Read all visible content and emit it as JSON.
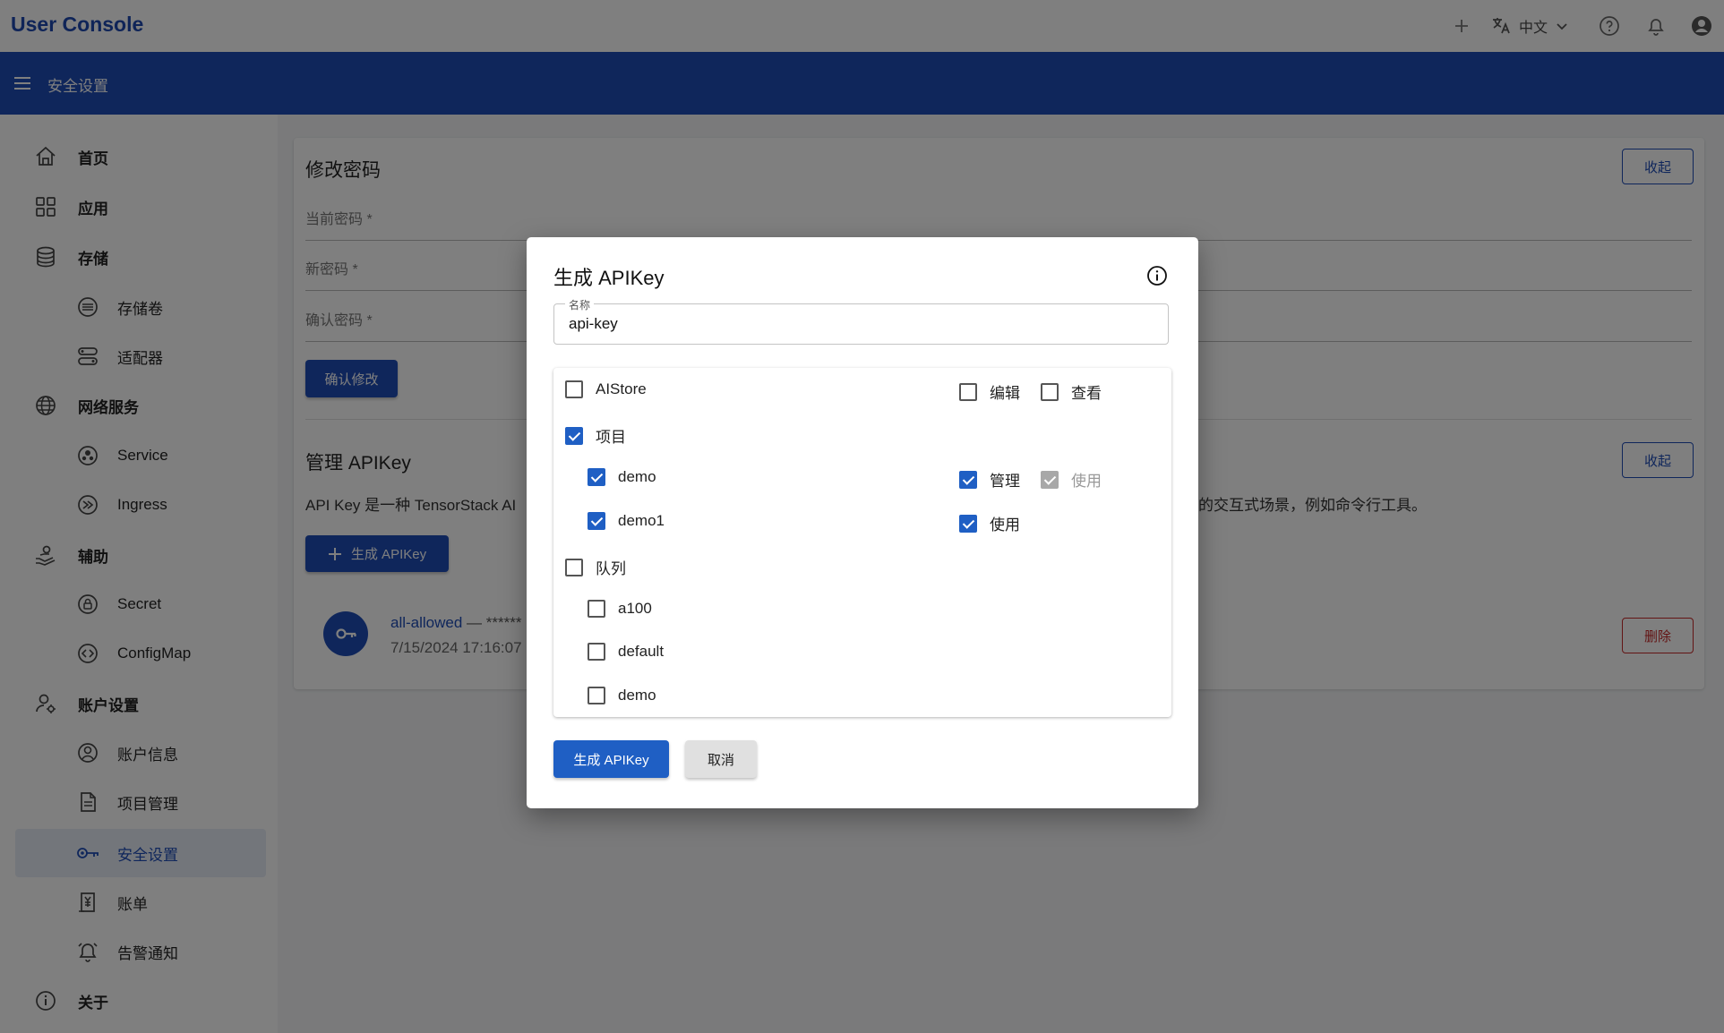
{
  "header": {
    "brand": "User Console",
    "language": "中文"
  },
  "subbar": {
    "title": "安全设置"
  },
  "sidebar": {
    "items": [
      {
        "label": "首页",
        "icon": "home-icon"
      },
      {
        "label": "应用",
        "icon": "apps-icon"
      },
      {
        "label": "存储",
        "icon": "database-icon"
      },
      {
        "label": "存储卷",
        "icon": "volume-icon"
      },
      {
        "label": "适配器",
        "icon": "adapter-icon"
      },
      {
        "label": "网络服务",
        "icon": "globe-icon"
      },
      {
        "label": "Service",
        "icon": "service-icon"
      },
      {
        "label": "Ingress",
        "icon": "ingress-icon"
      },
      {
        "label": "辅助",
        "icon": "assist-icon"
      },
      {
        "label": "Secret",
        "icon": "lock-icon"
      },
      {
        "label": "ConfigMap",
        "icon": "code-icon"
      },
      {
        "label": "账户设置",
        "icon": "account-settings-icon"
      },
      {
        "label": "账户信息",
        "icon": "account-circle-icon"
      },
      {
        "label": "项目管理",
        "icon": "document-icon"
      },
      {
        "label": "安全设置",
        "icon": "key-icon"
      },
      {
        "label": "账单",
        "icon": "bill-icon"
      },
      {
        "label": "告警通知",
        "icon": "alarm-icon"
      },
      {
        "label": "关于",
        "icon": "info-icon"
      }
    ]
  },
  "password_card": {
    "title": "修改密码",
    "collapse_label": "收起",
    "current_password": "当前密码 *",
    "new_password": "新密码 *",
    "confirm_password": "确认密码 *",
    "submit_label": "确认修改"
  },
  "apikey_card": {
    "title": "管理 APIKey",
    "collapse_label": "收起",
    "description_left": "API Key 是一种 TensorStack AI",
    "description_right": "的交互式场景，例如命令行工具。",
    "generate_label": "生成 APIKey",
    "key_name": "all-allowed",
    "key_dash": " — ******",
    "key_time": "7/15/2024 17:16:07",
    "delete_label": "删除"
  },
  "dialog": {
    "title": "生成 APIKey",
    "name_legend": "名称",
    "name_value": "api-key",
    "permissions": {
      "aistore": {
        "label": "AIStore",
        "checked": false,
        "edit": "编辑",
        "edit_checked": false,
        "view": "查看",
        "view_checked": false
      },
      "projects": {
        "label": "项目",
        "checked": true
      },
      "project_items": [
        {
          "label": "demo",
          "checked": true,
          "perm1": "管理",
          "perm1_checked": true,
          "perm2": "使用",
          "perm2_checked": true,
          "perm2_disabled": true
        },
        {
          "label": "demo1",
          "checked": true,
          "perm1": "使用",
          "perm1_checked": true
        }
      ],
      "queues": {
        "label": "队列",
        "checked": false
      },
      "queue_items": [
        {
          "label": "a100",
          "checked": false
        },
        {
          "label": "default",
          "checked": false
        },
        {
          "label": "demo",
          "checked": false
        }
      ]
    },
    "generate_label": "生成 APIKey",
    "cancel_label": "取消"
  },
  "colors": {
    "primary": "#1f4db7",
    "danger": "#c62828",
    "checkbox": "#1f5fc4"
  }
}
